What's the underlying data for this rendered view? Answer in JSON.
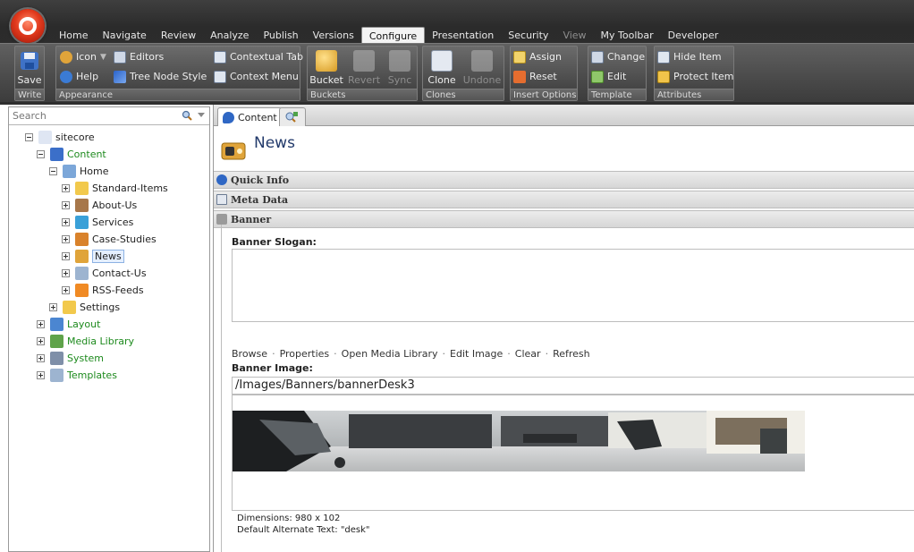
{
  "ribbon": {
    "tabs": [
      {
        "label": "Home",
        "active": false,
        "dim": false
      },
      {
        "label": "Navigate",
        "active": false,
        "dim": false
      },
      {
        "label": "Review",
        "active": false,
        "dim": false
      },
      {
        "label": "Analyze",
        "active": false,
        "dim": false
      },
      {
        "label": "Publish",
        "active": false,
        "dim": false
      },
      {
        "label": "Versions",
        "active": false,
        "dim": false
      },
      {
        "label": "Configure",
        "active": true,
        "dim": false
      },
      {
        "label": "Presentation",
        "active": false,
        "dim": false
      },
      {
        "label": "Security",
        "active": false,
        "dim": false
      },
      {
        "label": "View",
        "active": false,
        "dim": true
      },
      {
        "label": "My Toolbar",
        "active": false,
        "dim": false
      },
      {
        "label": "Developer",
        "active": false,
        "dim": false
      }
    ],
    "write": {
      "label": "Write",
      "save": "Save"
    },
    "appearance": {
      "label": "Appearance",
      "icon": "Icon",
      "editors": "Editors",
      "help": "Help",
      "tree_node_style": "Tree Node Style",
      "contextual_tab": "Contextual Tab",
      "context_menu": "Context Menu"
    },
    "buckets": {
      "label": "Buckets",
      "bucket": "Bucket",
      "revert": "Revert",
      "sync": "Sync"
    },
    "clones": {
      "label": "Clones",
      "clone": "Clone",
      "undone": "Undone"
    },
    "insert_options": {
      "label": "Insert Options",
      "assign": "Assign",
      "reset": "Reset"
    },
    "template": {
      "label": "Template",
      "change": "Change",
      "edit": "Edit"
    },
    "attributes": {
      "label": "Attributes",
      "hide_item": "Hide Item",
      "protect_item": "Protect Item"
    }
  },
  "search": {
    "placeholder": "Search"
  },
  "tree": [
    {
      "label": "sitecore",
      "level": 0,
      "toggle": "minus",
      "icon": "page-icon",
      "color": "#dfe6f3",
      "green": false,
      "selected": false
    },
    {
      "label": "Content",
      "level": 1,
      "toggle": "minus",
      "icon": "content-icon",
      "color": "#3b6fc9",
      "green": true,
      "selected": false
    },
    {
      "label": "Home",
      "level": 2,
      "toggle": "minus",
      "icon": "home-icon",
      "color": "#7ca7d9",
      "green": false,
      "selected": false
    },
    {
      "label": "Standard-Items",
      "level": 3,
      "toggle": "plus",
      "icon": "folder-icon",
      "color": "#f2c94c",
      "green": false,
      "selected": false
    },
    {
      "label": "About-Us",
      "level": 3,
      "toggle": "plus",
      "icon": "person-icon",
      "color": "#a7774a",
      "green": false,
      "selected": false
    },
    {
      "label": "Services",
      "level": 3,
      "toggle": "plus",
      "icon": "globe-icon",
      "color": "#3aa0d8",
      "green": false,
      "selected": false
    },
    {
      "label": "Case-Studies",
      "level": 3,
      "toggle": "plus",
      "icon": "document-icon",
      "color": "#d9822b",
      "green": false,
      "selected": false
    },
    {
      "label": "News",
      "level": 3,
      "toggle": "plus",
      "icon": "news-icon",
      "color": "#e0a43a",
      "green": false,
      "selected": true
    },
    {
      "label": "Contact-Us",
      "level": 3,
      "toggle": "plus",
      "icon": "contact-icon",
      "color": "#9db4d0",
      "green": false,
      "selected": false
    },
    {
      "label": "RSS-Feeds",
      "level": 3,
      "toggle": "plus",
      "icon": "rss-icon",
      "color": "#f08a24",
      "green": false,
      "selected": false
    },
    {
      "label": "Settings",
      "level": 2,
      "toggle": "plus",
      "icon": "folder-icon",
      "color": "#f2c94c",
      "green": false,
      "selected": false
    },
    {
      "label": "Layout",
      "level": 1,
      "toggle": "plus",
      "icon": "layout-icon",
      "color": "#4b86d1",
      "green": true,
      "selected": false
    },
    {
      "label": "Media Library",
      "level": 1,
      "toggle": "plus",
      "icon": "media-icon",
      "color": "#5fa34a",
      "green": true,
      "selected": false
    },
    {
      "label": "System",
      "level": 1,
      "toggle": "plus",
      "icon": "system-icon",
      "color": "#7f8fa8",
      "green": true,
      "selected": false
    },
    {
      "label": "Templates",
      "level": 1,
      "toggle": "plus",
      "icon": "templates-icon",
      "color": "#9db4d0",
      "green": true,
      "selected": false
    }
  ],
  "editor": {
    "tab_content": "Content",
    "item_title": "News",
    "sections": {
      "quick_info": "Quick Info",
      "meta_data": "Meta Data",
      "banner": "Banner"
    },
    "banner_slogan_label": "Banner Slogan:",
    "image_tools": [
      "Browse",
      "Properties",
      "Open Media Library",
      "Edit Image",
      "Clear",
      "Refresh"
    ],
    "banner_image_label": "Banner Image:",
    "image_path": "/Images/Banners/bannerDesk3",
    "dimensions": "Dimensions: 980 x 102",
    "alt_text": "Default Alternate Text: \"desk\""
  }
}
